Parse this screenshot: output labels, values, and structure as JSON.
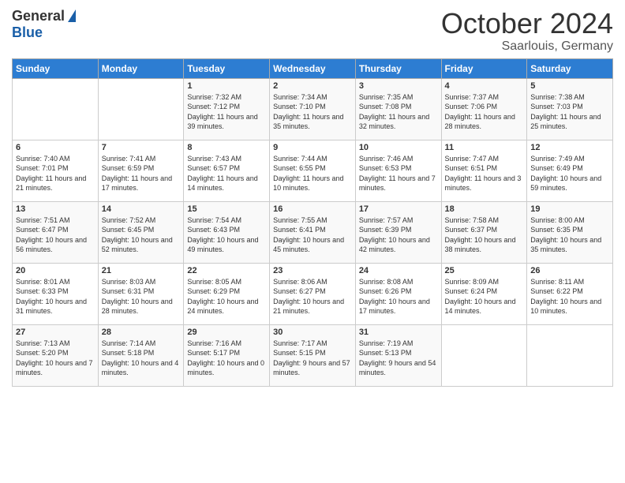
{
  "header": {
    "logo_general": "General",
    "logo_blue": "Blue",
    "month_title": "October 2024",
    "location": "Saarlouis, Germany"
  },
  "days_of_week": [
    "Sunday",
    "Monday",
    "Tuesday",
    "Wednesday",
    "Thursday",
    "Friday",
    "Saturday"
  ],
  "weeks": [
    [
      {
        "day": "",
        "sunrise": "",
        "sunset": "",
        "daylight": ""
      },
      {
        "day": "",
        "sunrise": "",
        "sunset": "",
        "daylight": ""
      },
      {
        "day": "1",
        "sunrise": "Sunrise: 7:32 AM",
        "sunset": "Sunset: 7:12 PM",
        "daylight": "Daylight: 11 hours and 39 minutes."
      },
      {
        "day": "2",
        "sunrise": "Sunrise: 7:34 AM",
        "sunset": "Sunset: 7:10 PM",
        "daylight": "Daylight: 11 hours and 35 minutes."
      },
      {
        "day": "3",
        "sunrise": "Sunrise: 7:35 AM",
        "sunset": "Sunset: 7:08 PM",
        "daylight": "Daylight: 11 hours and 32 minutes."
      },
      {
        "day": "4",
        "sunrise": "Sunrise: 7:37 AM",
        "sunset": "Sunset: 7:06 PM",
        "daylight": "Daylight: 11 hours and 28 minutes."
      },
      {
        "day": "5",
        "sunrise": "Sunrise: 7:38 AM",
        "sunset": "Sunset: 7:03 PM",
        "daylight": "Daylight: 11 hours and 25 minutes."
      }
    ],
    [
      {
        "day": "6",
        "sunrise": "Sunrise: 7:40 AM",
        "sunset": "Sunset: 7:01 PM",
        "daylight": "Daylight: 11 hours and 21 minutes."
      },
      {
        "day": "7",
        "sunrise": "Sunrise: 7:41 AM",
        "sunset": "Sunset: 6:59 PM",
        "daylight": "Daylight: 11 hours and 17 minutes."
      },
      {
        "day": "8",
        "sunrise": "Sunrise: 7:43 AM",
        "sunset": "Sunset: 6:57 PM",
        "daylight": "Daylight: 11 hours and 14 minutes."
      },
      {
        "day": "9",
        "sunrise": "Sunrise: 7:44 AM",
        "sunset": "Sunset: 6:55 PM",
        "daylight": "Daylight: 11 hours and 10 minutes."
      },
      {
        "day": "10",
        "sunrise": "Sunrise: 7:46 AM",
        "sunset": "Sunset: 6:53 PM",
        "daylight": "Daylight: 11 hours and 7 minutes."
      },
      {
        "day": "11",
        "sunrise": "Sunrise: 7:47 AM",
        "sunset": "Sunset: 6:51 PM",
        "daylight": "Daylight: 11 hours and 3 minutes."
      },
      {
        "day": "12",
        "sunrise": "Sunrise: 7:49 AM",
        "sunset": "Sunset: 6:49 PM",
        "daylight": "Daylight: 10 hours and 59 minutes."
      }
    ],
    [
      {
        "day": "13",
        "sunrise": "Sunrise: 7:51 AM",
        "sunset": "Sunset: 6:47 PM",
        "daylight": "Daylight: 10 hours and 56 minutes."
      },
      {
        "day": "14",
        "sunrise": "Sunrise: 7:52 AM",
        "sunset": "Sunset: 6:45 PM",
        "daylight": "Daylight: 10 hours and 52 minutes."
      },
      {
        "day": "15",
        "sunrise": "Sunrise: 7:54 AM",
        "sunset": "Sunset: 6:43 PM",
        "daylight": "Daylight: 10 hours and 49 minutes."
      },
      {
        "day": "16",
        "sunrise": "Sunrise: 7:55 AM",
        "sunset": "Sunset: 6:41 PM",
        "daylight": "Daylight: 10 hours and 45 minutes."
      },
      {
        "day": "17",
        "sunrise": "Sunrise: 7:57 AM",
        "sunset": "Sunset: 6:39 PM",
        "daylight": "Daylight: 10 hours and 42 minutes."
      },
      {
        "day": "18",
        "sunrise": "Sunrise: 7:58 AM",
        "sunset": "Sunset: 6:37 PM",
        "daylight": "Daylight: 10 hours and 38 minutes."
      },
      {
        "day": "19",
        "sunrise": "Sunrise: 8:00 AM",
        "sunset": "Sunset: 6:35 PM",
        "daylight": "Daylight: 10 hours and 35 minutes."
      }
    ],
    [
      {
        "day": "20",
        "sunrise": "Sunrise: 8:01 AM",
        "sunset": "Sunset: 6:33 PM",
        "daylight": "Daylight: 10 hours and 31 minutes."
      },
      {
        "day": "21",
        "sunrise": "Sunrise: 8:03 AM",
        "sunset": "Sunset: 6:31 PM",
        "daylight": "Daylight: 10 hours and 28 minutes."
      },
      {
        "day": "22",
        "sunrise": "Sunrise: 8:05 AM",
        "sunset": "Sunset: 6:29 PM",
        "daylight": "Daylight: 10 hours and 24 minutes."
      },
      {
        "day": "23",
        "sunrise": "Sunrise: 8:06 AM",
        "sunset": "Sunset: 6:27 PM",
        "daylight": "Daylight: 10 hours and 21 minutes."
      },
      {
        "day": "24",
        "sunrise": "Sunrise: 8:08 AM",
        "sunset": "Sunset: 6:26 PM",
        "daylight": "Daylight: 10 hours and 17 minutes."
      },
      {
        "day": "25",
        "sunrise": "Sunrise: 8:09 AM",
        "sunset": "Sunset: 6:24 PM",
        "daylight": "Daylight: 10 hours and 14 minutes."
      },
      {
        "day": "26",
        "sunrise": "Sunrise: 8:11 AM",
        "sunset": "Sunset: 6:22 PM",
        "daylight": "Daylight: 10 hours and 10 minutes."
      }
    ],
    [
      {
        "day": "27",
        "sunrise": "Sunrise: 7:13 AM",
        "sunset": "Sunset: 5:20 PM",
        "daylight": "Daylight: 10 hours and 7 minutes."
      },
      {
        "day": "28",
        "sunrise": "Sunrise: 7:14 AM",
        "sunset": "Sunset: 5:18 PM",
        "daylight": "Daylight: 10 hours and 4 minutes."
      },
      {
        "day": "29",
        "sunrise": "Sunrise: 7:16 AM",
        "sunset": "Sunset: 5:17 PM",
        "daylight": "Daylight: 10 hours and 0 minutes."
      },
      {
        "day": "30",
        "sunrise": "Sunrise: 7:17 AM",
        "sunset": "Sunset: 5:15 PM",
        "daylight": "Daylight: 9 hours and 57 minutes."
      },
      {
        "day": "31",
        "sunrise": "Sunrise: 7:19 AM",
        "sunset": "Sunset: 5:13 PM",
        "daylight": "Daylight: 9 hours and 54 minutes."
      },
      {
        "day": "",
        "sunrise": "",
        "sunset": "",
        "daylight": ""
      },
      {
        "day": "",
        "sunrise": "",
        "sunset": "",
        "daylight": ""
      }
    ]
  ]
}
